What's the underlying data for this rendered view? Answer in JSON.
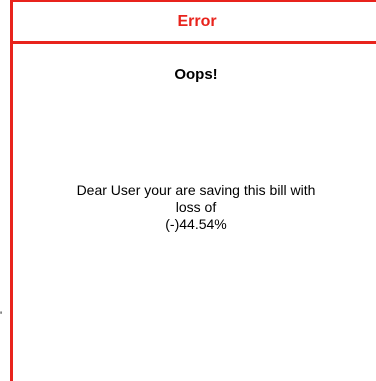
{
  "dialog": {
    "title": "Error",
    "heading": "Oops!",
    "message_lines": [
      "Dear User your are saving this bill with",
      "loss of",
      "(-)44.54%"
    ]
  },
  "colors": {
    "accent": "#e8231c",
    "text": "#000000",
    "background": "#ffffff"
  }
}
